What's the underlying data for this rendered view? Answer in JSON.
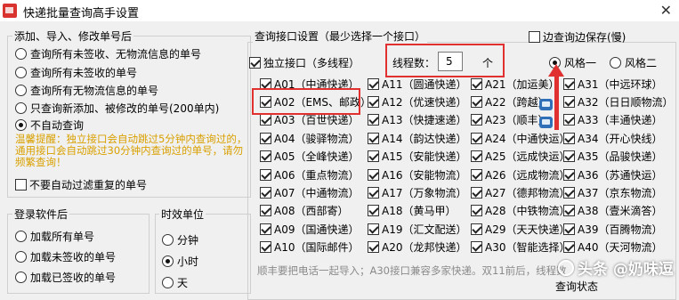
{
  "window": {
    "title": "快递批量查询高手设置",
    "close_label": "✕"
  },
  "group_add": {
    "title": "添加、导入、修改单号后",
    "options": [
      {
        "label": "查询所有未签收、无物流信息的单号",
        "checked": false
      },
      {
        "label": "查询所有未签收的单号",
        "checked": false
      },
      {
        "label": "查询所有无物流信息的单号",
        "checked": false
      },
      {
        "label": "只查询新添加、被修改的单号(200单内)",
        "checked": false
      },
      {
        "label": "不自动查询",
        "checked": true
      }
    ],
    "warning": "温馨提醒：独立接口会自动跳过5分钟内查询过的，通用接口会自动跳过30分钟内查询过的单号，请勿频繁查询！",
    "filter_label": "不要自动过滤重复的单号",
    "filter_checked": false
  },
  "group_login": {
    "title": "登录软件后",
    "options": [
      {
        "label": "加载所有单号",
        "checked": false
      },
      {
        "label": "加载未签收的单号",
        "checked": false
      },
      {
        "label": "加载已签收的单号",
        "checked": false
      }
    ]
  },
  "group_time": {
    "title": "时效单位",
    "options": [
      {
        "label": "分钟",
        "checked": false
      },
      {
        "label": "小时",
        "checked": true
      },
      {
        "label": "天",
        "checked": false
      }
    ]
  },
  "group_api": {
    "title": "查询接口设置（最少选择一个接口）",
    "save_label": "边查询边保存(慢)",
    "save_checked": false,
    "independent_label": "独立接口（多线程）",
    "independent_checked": true,
    "threads_label": "线程数：",
    "threads_value": "5",
    "threads_unit": "个",
    "style1_label": "风格一",
    "style1_checked": true,
    "style2_label": "风格二",
    "style2_checked": false,
    "footnote": "顺丰要把电话一起导入；A30接口兼容多家快递。双11前后，线程数",
    "cut_text": "查询状态"
  },
  "couriers": {
    "col1": [
      "A01（中通快递）",
      "A02（EMS、邮政）",
      "A03（百世快递）",
      "A04（骏驿物流）",
      "A05（全峰快递）",
      "A06（重点物流）",
      "A07（中通物流）",
      "A08（西部寄）",
      "A09（国通快递）",
      "A10（国际邮件）"
    ],
    "col2": [
      "A11（圆通快递）",
      "A12（优速快递）",
      "A13（快捷速递）",
      "A14（韵达快递）",
      "A15（安能快递）",
      "A16（安能物流）",
      "A17（万象物流）",
      "A18（黄马甲）",
      "A19（汇文配送）",
      "A20（龙邦快递）"
    ],
    "col3": [
      "A21（加运美）",
      "A22（跨越）",
      "A23（顺丰）",
      "A24（中通快运）",
      "A25（远成快运）",
      "A26（远成物流）",
      "A27（德邦物流）",
      "A28（中铁物流）",
      "A29（天天快递）",
      "A30（智能选择）"
    ],
    "col4": [
      "A31（中远环球）",
      "A32（日日顺物流）",
      "A33（丰通快递）",
      "A34（开心快线）",
      "A35（品骏快递）",
      "A36（苏通快运）",
      "A37（京东物流）",
      "A38（壹米滴答）",
      "A39（百腾物流）",
      "A40（天河物流）"
    ]
  },
  "watermark": "头条 @奶味逗",
  "colors": {
    "annotation_red": "#e03030",
    "warning_text": "#d9a000",
    "footnote_gray": "#8a8a8a"
  }
}
